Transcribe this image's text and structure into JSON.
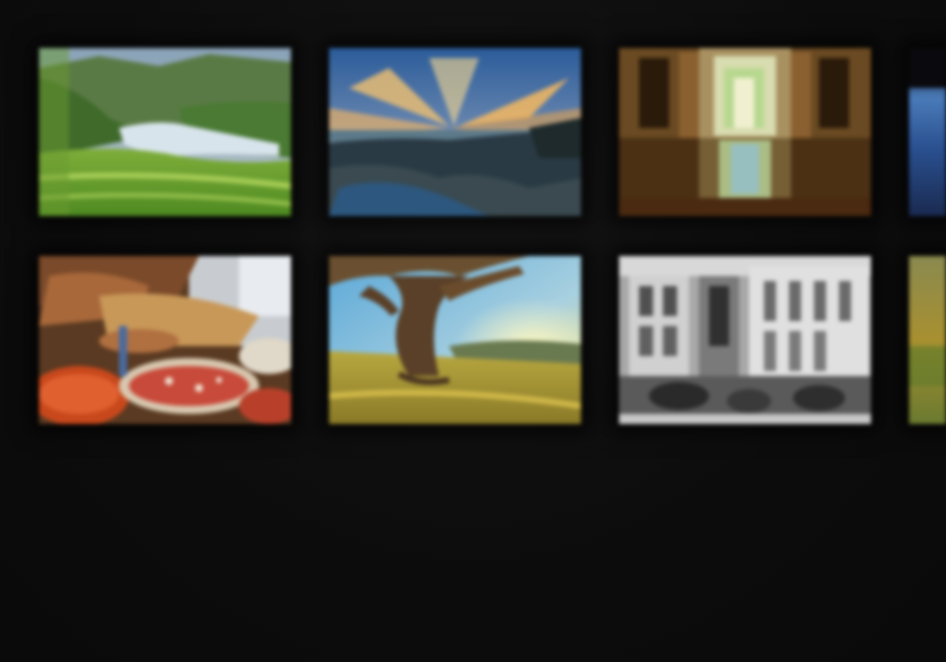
{
  "gallery": {
    "rows": 2,
    "visible_columns": 4,
    "background_color": "#0c0c0c",
    "thumbnails": [
      {
        "subject": "green-valley-river",
        "row": 1,
        "column": 1,
        "palette": [
          "#5f8a3a",
          "#9fc24a",
          "#c8d8e6"
        ]
      },
      {
        "subject": "sunset-coast-clouds",
        "row": 1,
        "column": 2,
        "palette": [
          "#e8a84a",
          "#2e5a8c",
          "#2a3a40"
        ]
      },
      {
        "subject": "reflective-corridor",
        "row": 1,
        "column": 3,
        "palette": [
          "#6a4420",
          "#c9b070",
          "#b8d8a0"
        ]
      },
      {
        "subject": "blue-water-partial",
        "row": 1,
        "column": 4,
        "palette": [
          "#1a3a70",
          "#4c7cc0"
        ]
      },
      {
        "subject": "market-spices",
        "row": 2,
        "column": 1,
        "palette": [
          "#b84a2a",
          "#d8c8a0",
          "#6a3a20"
        ]
      },
      {
        "subject": "tree-on-hill-sunset",
        "row": 2,
        "column": 2,
        "palette": [
          "#c8b040",
          "#6ab0d8",
          "#4a3a28"
        ]
      },
      {
        "subject": "monochrome-street",
        "row": 2,
        "column": 3,
        "palette": [
          "#d0d0d0",
          "#404040",
          "#888888"
        ]
      },
      {
        "subject": "golden-field-partial",
        "row": 2,
        "column": 4,
        "palette": [
          "#a89030",
          "#6a7a30"
        ]
      }
    ]
  }
}
